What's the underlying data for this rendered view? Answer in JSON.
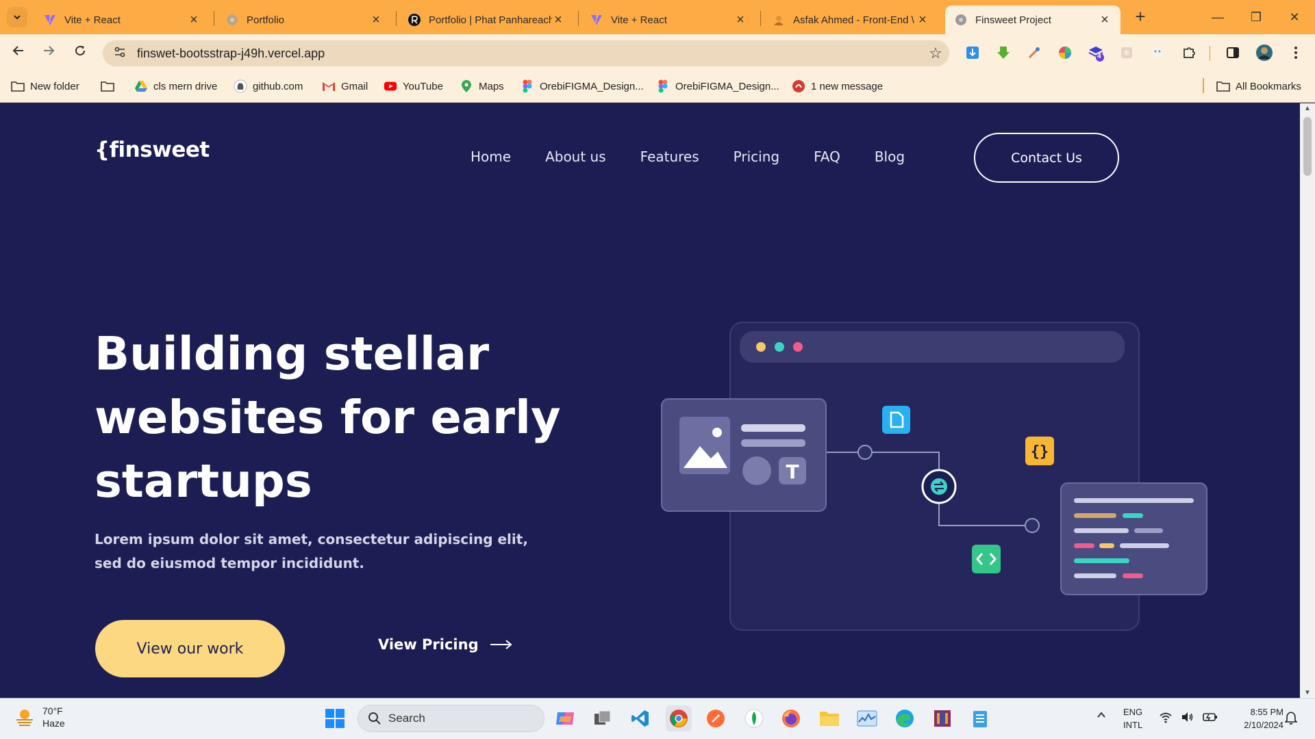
{
  "browser": {
    "tabs": [
      {
        "title": "Vite + React",
        "icon": "vite-icon",
        "active": false
      },
      {
        "title": "Portfolio",
        "icon": "globe-icon",
        "active": false
      },
      {
        "title": "Portfolio | Phat Panhareach",
        "icon": "r-logo-icon",
        "active": false
      },
      {
        "title": "Vite + React",
        "icon": "vite-icon",
        "active": false
      },
      {
        "title": "Asfak Ahmed - Front-End \\",
        "icon": "avatar-icon",
        "active": false
      },
      {
        "title": "Finsweet Project",
        "icon": "globe-icon",
        "active": true
      }
    ],
    "url": "finswet-bootsstrap-j49h.vercel.app",
    "bookmarks": [
      {
        "label": "New folder",
        "icon": "folder-icon"
      },
      {
        "label": "",
        "icon": "folder-icon"
      },
      {
        "label": "cls mern drive",
        "icon": "google-drive-icon"
      },
      {
        "label": "github.com",
        "icon": "github-icon"
      },
      {
        "label": "Gmail",
        "icon": "gmail-icon"
      },
      {
        "label": "YouTube",
        "icon": "youtube-icon"
      },
      {
        "label": "Maps",
        "icon": "maps-icon"
      },
      {
        "label": "OrebiFIGMA_Design...",
        "icon": "figma-icon"
      },
      {
        "label": "OrebiFIGMA_Design...",
        "icon": "figma-icon"
      },
      {
        "label": "1 new message",
        "icon": "notification-icon"
      }
    ],
    "all_bookmarks": "All Bookmarks",
    "extension_badge": "4",
    "colors": {
      "tabstrip": "#fdac45",
      "toolbar": "#fcefdc"
    }
  },
  "site": {
    "logo": "{finsweet",
    "nav": [
      "Home",
      "About us",
      "Features",
      "Pricing",
      "FAQ",
      "Blog"
    ],
    "contact": "Contact Us",
    "hero": {
      "title_lines": [
        "Building stellar",
        "websites for early",
        "startups"
      ],
      "subtitle": "Lorem ipsum dolor sit amet, consectetur adipiscing elit, sed do eiusmod tempor incididunt.",
      "primary_cta": "View our work",
      "secondary_cta": "View Pricing"
    },
    "colors": {
      "background": "#1c1e53",
      "accent": "#fcd980",
      "text": "#ffffff"
    }
  },
  "taskbar": {
    "weather": {
      "temp": "70°F",
      "condition": "Haze"
    },
    "search": "Search",
    "lang": {
      "primary": "ENG",
      "secondary": "INTL"
    },
    "time": "8:55 PM",
    "date": "2/10/2024"
  }
}
